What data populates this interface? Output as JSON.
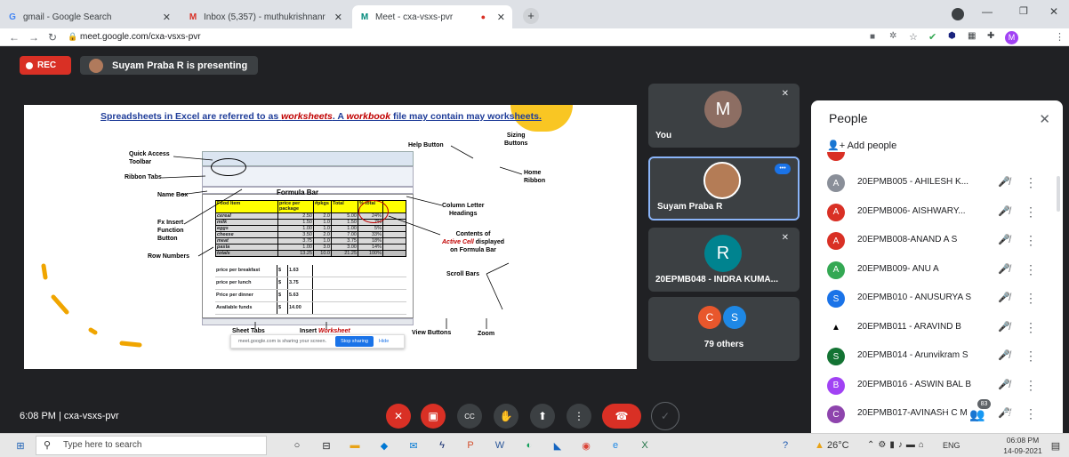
{
  "browser": {
    "tabs": [
      {
        "title": "gmail - Google Search",
        "icon": "G"
      },
      {
        "title": "Inbox (5,357) - muthukrishnanr",
        "icon": "M"
      },
      {
        "title": "Meet - cxa-vsxs-pvr",
        "icon": "M"
      }
    ],
    "new_tab": "+",
    "url": "meet.google.com/cxa-vsxs-pvr",
    "profile_initial": "M"
  },
  "meet": {
    "rec_label": "REC",
    "presenting": "Suyam Praba R is presenting",
    "tiles": {
      "you": {
        "initial": "M",
        "name": "You"
      },
      "presenter": {
        "name": "Suyam Praba R"
      },
      "indra": {
        "initial": "R",
        "name": "20EPMB048 - INDRA KUMA..."
      },
      "others": {
        "initials": [
          "C",
          "S"
        ],
        "label": "79 others"
      }
    },
    "time_meeting": "6:08 PM  |  cxa-vsxs-pvr",
    "people_count": "83"
  },
  "people": {
    "title": "People",
    "add_label": "Add people",
    "rows": [
      {
        "initial": "A",
        "name": "20EPMB005 - AHILESH K...",
        "color": "#8a8f99"
      },
      {
        "initial": "A",
        "name": "20EPMB006- AISHWARY...",
        "color": "#d93025"
      },
      {
        "initial": "A",
        "name": "20EPMB008-ANAND A S",
        "color": "#d93025"
      },
      {
        "initial": "A",
        "name": "20EPMB009- ANU A",
        "color": "#34a853"
      },
      {
        "initial": "S",
        "name": "20EPMB010 - ANUSURYA S",
        "color": "#1a73e8"
      },
      {
        "initial": "▲",
        "name": "20EPMB011 - ARAVIND B",
        "color": "#ffffff"
      },
      {
        "initial": "S",
        "name": "20EPMB014 - Arunvikram S",
        "color": "#137333"
      },
      {
        "initial": "B",
        "name": "20EPMB016 - ASWIN BAL B",
        "color": "#a142f4"
      },
      {
        "initial": "C",
        "name": "20EPMB017-AVINASH C M",
        "color": "#8e44ad"
      }
    ]
  },
  "slide": {
    "heading_a": "Spreadsheets in Excel are referred to as ",
    "heading_b": "worksheets",
    "heading_c": ".  A ",
    "heading_d": "workbook",
    "heading_e": " file may contain may worksheets.",
    "labels": {
      "quick_access": "Quick Access\nToolbar",
      "ribbon_tabs": "Ribbon Tabs",
      "name_box": "Name Box",
      "fx_insert": "Fx Insert\nFunction\nButton",
      "row_numbers": "Row Numbers",
      "help_button": "Help Button",
      "sizing_buttons": "Sizing\nButtons",
      "home_ribbon": "Home\nRibbon",
      "formula_bar": "Formula Bar",
      "column_letter": "Column Letter\nHeadings",
      "contents_of": "Contents of",
      "active_cell": "Active Cell",
      "displayed": " displayed\non Formula Bar",
      "scroll_bars": "Scroll Bars",
      "sheet_tabs": "Sheet Tabs",
      "insert": "Insert ",
      "worksheet": "Worksheet",
      "view_buttons": "View Buttons",
      "zoom": "Zoom"
    },
    "table": {
      "headers": [
        "Food Item",
        "price per package",
        "#pkgs",
        "Total",
        "% total"
      ],
      "rows": [
        [
          "cereal",
          "2.50",
          "2.0",
          "5.00",
          "24%"
        ],
        [
          "milk",
          "1.50",
          "1.0",
          "1.50",
          "7%"
        ],
        [
          "eggs",
          "1.00",
          "1.0",
          "1.00",
          "5%"
        ],
        [
          "cheese",
          "3.50",
          "2.0",
          "7.00",
          "33%"
        ],
        [
          "meat",
          "3.75",
          "1.0",
          "3.75",
          "18%"
        ],
        [
          "pasta",
          "1.00",
          "3.0",
          "3.00",
          "14%"
        ],
        [
          "totals",
          "13.25",
          "10.0",
          "21.25",
          "100%"
        ]
      ],
      "extra": [
        [
          "price per breakfast",
          "$",
          "1.63"
        ],
        [
          "price per lunch",
          "$",
          "3.75"
        ],
        [
          "Price per dinner",
          "$",
          "5.63"
        ],
        [
          "Available funds",
          "$",
          "14.00"
        ]
      ]
    },
    "share_bar": {
      "text": "meet.google.com is sharing your screen.",
      "stop": "Stop sharing",
      "hide": "Hide"
    }
  },
  "taskbar": {
    "search_placeholder": "Type here to search",
    "weather": "26°C",
    "lang": "ENG",
    "time": "06:08 PM",
    "date": "14-09-2021"
  }
}
